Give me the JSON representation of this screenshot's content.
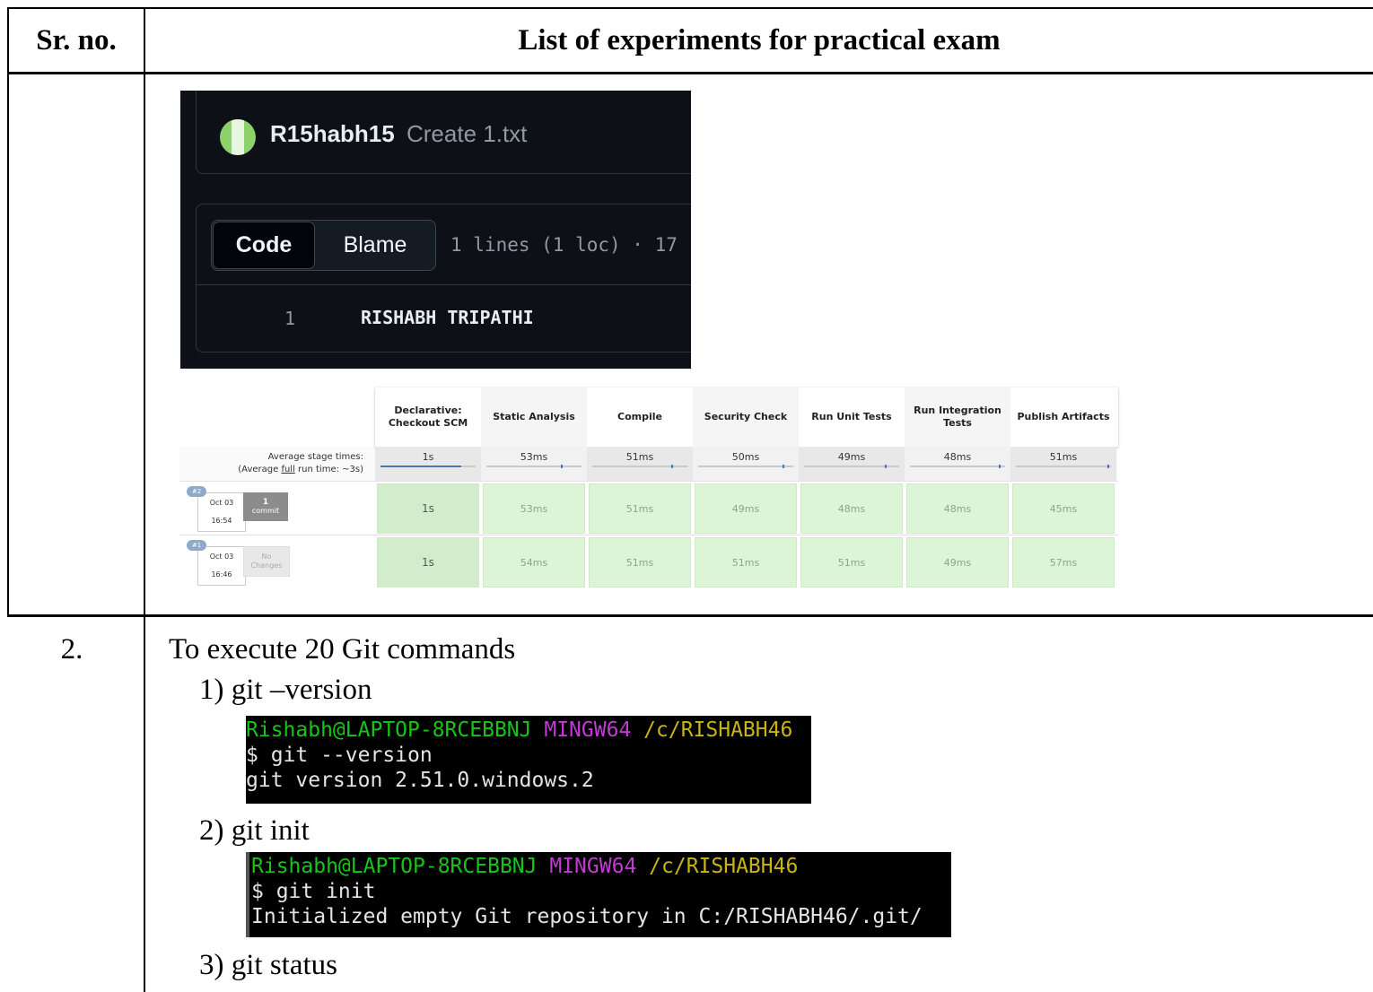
{
  "table": {
    "header": {
      "col1": "Sr. no.",
      "col2": "List of experiments for practical exam"
    }
  },
  "github": {
    "username": "R15habh15",
    "commit_message": "Create 1.txt",
    "tab_code": "Code",
    "tab_blame": "Blame",
    "file_meta": "1 lines (1 loc) · 17",
    "line_number": "1",
    "line_text": "RISHABH TRIPATHI"
  },
  "jenkins": {
    "stages": [
      "Declarative: Checkout SCM",
      "Static Analysis",
      "Compile",
      "Security Check",
      "Run Unit Tests",
      "Run Integration Tests",
      "Publish Artifacts"
    ],
    "avg_label_1": "Average stage times:",
    "avg_label_2_pre": "(Average ",
    "avg_label_2_full": "full",
    "avg_label_2_post": " run time: ~3s)",
    "avg_times": [
      "1s",
      "53ms",
      "51ms",
      "50ms",
      "49ms",
      "48ms",
      "51ms"
    ],
    "avg_fractions": [
      0.85,
      0.8,
      0.85,
      0.9,
      0.87,
      0.95,
      0.98
    ],
    "builds": [
      {
        "badge": "#2",
        "date": "Oct 03",
        "time": "16:54",
        "changes_count": "1",
        "changes_label": "commit",
        "times": [
          "1s",
          "53ms",
          "51ms",
          "49ms",
          "48ms",
          "48ms",
          "45ms"
        ]
      },
      {
        "badge": "#1",
        "date": "Oct 03",
        "time": "16:46",
        "changes_count": "No",
        "changes_label": "Changes",
        "times": [
          "1s",
          "54ms",
          "51ms",
          "51ms",
          "51ms",
          "49ms",
          "57ms"
        ]
      }
    ]
  },
  "row2": {
    "srno": "2.",
    "title": "To execute 20 Git commands",
    "items": [
      {
        "label": "1)  git –version"
      },
      {
        "label": "2)  git init"
      },
      {
        "label": "3)  git status"
      }
    ]
  },
  "terminal1": {
    "prompt_user": "Rishabh@LAPTOP-8RCEBBNJ",
    "prompt_env": "MINGW64",
    "prompt_path": "/c/RISHABH46",
    "command": "$ git --version",
    "output": "git version 2.51.0.windows.2"
  },
  "terminal2": {
    "prompt_user": "Rishabh@LAPTOP-8RCEBBNJ",
    "prompt_env": "MINGW64",
    "prompt_path": "/c/RISHABH46",
    "command": "$ git init",
    "output": "Initialized empty Git repository in C:/RISHABH46/.git/"
  }
}
